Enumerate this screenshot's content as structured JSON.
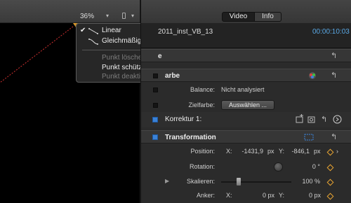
{
  "viewer": {
    "zoom": "36%",
    "zoom_arrow": "▾",
    "view_arrow": "▾"
  },
  "menu": {
    "items": [
      {
        "label": "Linear",
        "checked": true,
        "check": "✔",
        "enabled": true
      },
      {
        "label": "Gleichmäßig",
        "checked": false,
        "enabled": true
      },
      {
        "label": "Punkt löschen",
        "enabled": false
      },
      {
        "label": "Punkt schützen",
        "enabled": true
      },
      {
        "label": "Punkt deaktivieren",
        "enabled": false
      }
    ]
  },
  "inspector": {
    "tabs": {
      "video": "Video",
      "info": "Info"
    },
    "clip_name": "2011_inst_VB_13",
    "timecode": "00:00:10:03",
    "color_section": {
      "title": "arbe",
      "balance_label": "Balance:",
      "balance_value": "Nicht analysiert",
      "target_label": "Zielfarbe:",
      "target_button": "Auswählen ..."
    },
    "correction": {
      "title": "Korrektur 1:"
    },
    "transform": {
      "title": "Transformation",
      "position_label": "Position:",
      "x_label": "X:",
      "x_value": "-1431,9",
      "x_unit": "px",
      "y_label": "Y:",
      "y_value": "-846,1",
      "y_unit": "px",
      "rotation_label": "Rotation:",
      "rotation_value": "0 °",
      "scale_label": "Skalieren:",
      "scale_value": "100 %",
      "anchor_label": "Anker:",
      "anchor_x_label": "X:",
      "anchor_x_value": "0 px",
      "anchor_y_label": "Y:",
      "anchor_y_value": "0 px"
    }
  },
  "colors": {
    "accent_blue": "#3b82d6",
    "keyframe_orange": "#e8a431",
    "timecode_blue": "#5aa9e6"
  }
}
